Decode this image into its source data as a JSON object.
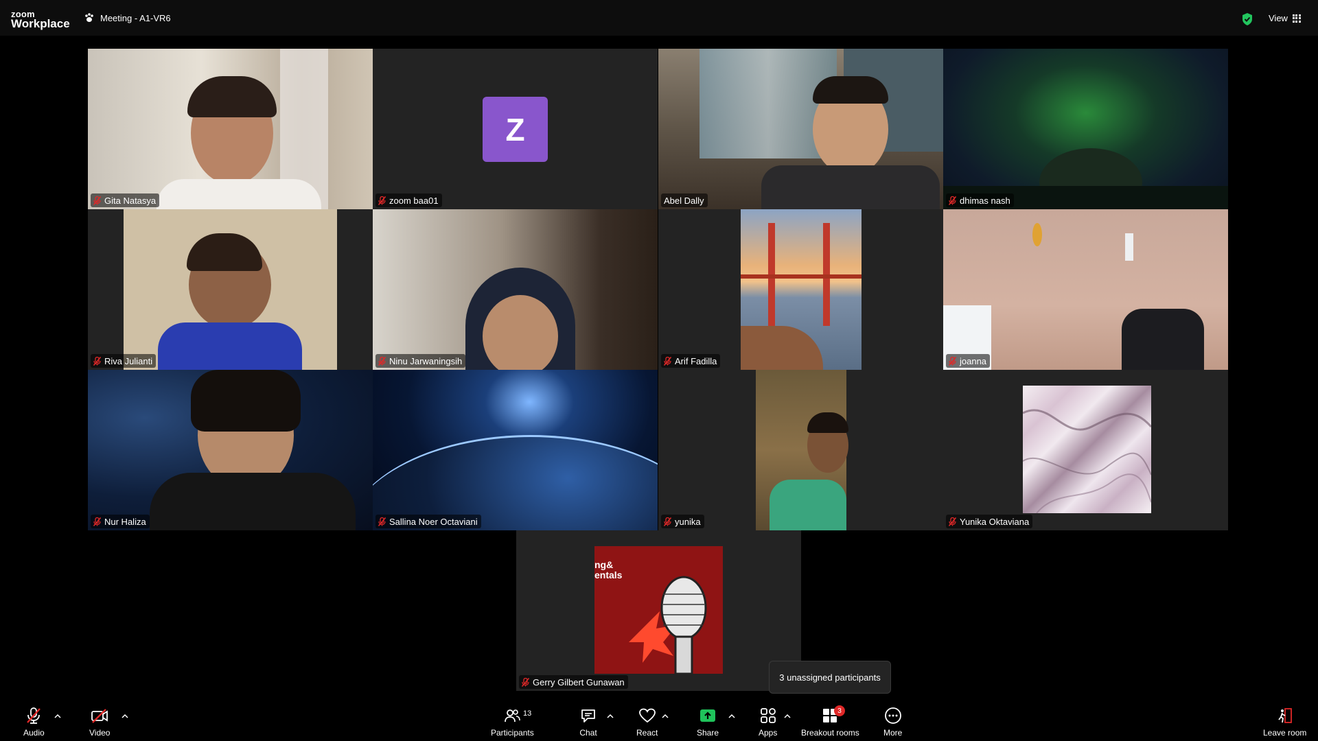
{
  "header": {
    "logo_top": "zoom",
    "logo_bottom": "Workplace",
    "meeting_title": "Meeting - A1-VR6",
    "view_label": "View"
  },
  "participants": [
    {
      "name": "Gita Natasya",
      "muted": true,
      "video": "camera"
    },
    {
      "name": "zoom baa01",
      "muted": true,
      "video": "avatar",
      "avatar_letter": "Z",
      "avatar_color": "#8956cc"
    },
    {
      "name": "Abel Dally",
      "muted": false,
      "video": "camera",
      "active_speaker": true
    },
    {
      "name": "dhimas nash",
      "muted": true,
      "video": "aurora-background"
    },
    {
      "name": "Riva Julianti",
      "muted": true,
      "video": "camera"
    },
    {
      "name": "Ninu Jarwaningsih",
      "muted": true,
      "video": "camera"
    },
    {
      "name": "Arif Fadilla",
      "muted": true,
      "video": "bridge-image"
    },
    {
      "name": "joanna",
      "muted": true,
      "video": "camera"
    },
    {
      "name": "Nur Haliza",
      "muted": true,
      "video": "camera"
    },
    {
      "name": "Sallina Noer Octaviani",
      "muted": true,
      "video": "earth-background"
    },
    {
      "name": "yunika",
      "muted": true,
      "video": "camera"
    },
    {
      "name": "Yunika Oktaviana",
      "muted": true,
      "video": "marble-image"
    },
    {
      "name": "Gerry Gilbert Gunawan",
      "muted": true,
      "video": "podcast-image",
      "image_text": "ng&\nentals"
    }
  ],
  "tooltip": "3 unassigned participants",
  "toolbar": {
    "audio": "Audio",
    "video": "Video",
    "participants": "Participants",
    "participants_count": "13",
    "chat": "Chat",
    "react": "React",
    "share": "Share",
    "apps": "Apps",
    "breakout": "Breakout rooms",
    "breakout_badge": "3",
    "more": "More",
    "leave": "Leave room"
  },
  "colors": {
    "active_speaker": "#22c984",
    "share_green": "#1fc35b",
    "badge_red": "#e02828",
    "muted_red": "#e02828"
  }
}
